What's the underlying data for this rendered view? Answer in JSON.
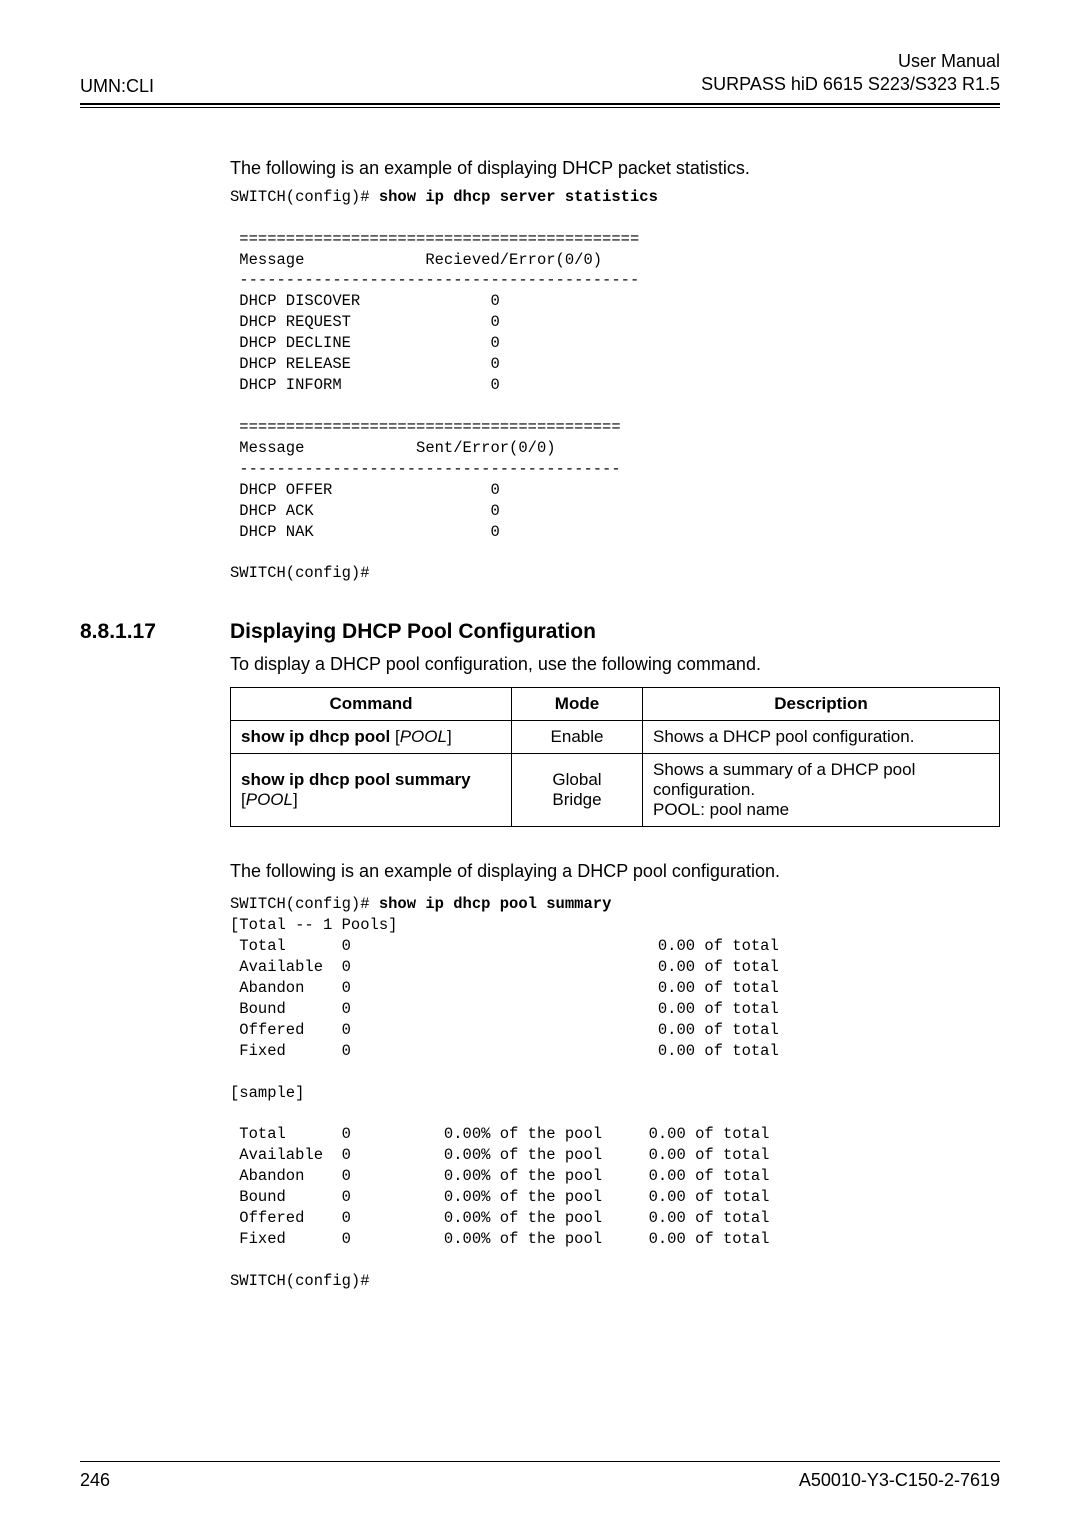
{
  "header": {
    "left": "UMN:CLI",
    "right_line1": "User Manual",
    "right_line2": "SURPASS hiD 6615 S223/S323 R1.5"
  },
  "intro_text": "The following is an example of displaying DHCP packet statistics.",
  "code1_prefix": "SWITCH(config)# ",
  "code1_cmd": "show ip dhcp server statistics",
  "code1_body": " ===========================================\n Message             Recieved/Error(0/0)\n -------------------------------------------\n DHCP DISCOVER              0\n DHCP REQUEST               0\n DHCP DECLINE               0\n DHCP RELEASE               0\n DHCP INFORM                0\n\n =========================================\n Message            Sent/Error(0/0)\n -----------------------------------------\n DHCP OFFER                 0\n DHCP ACK                   0\n DHCP NAK                   0\n\nSWITCH(config)#",
  "section": {
    "num": "8.8.1.17",
    "title": "Displaying DHCP Pool Configuration"
  },
  "para1": "To display a DHCP pool configuration, use the following command.",
  "table": {
    "head": {
      "c1": "Command",
      "c2": "Mode",
      "c3": "Description"
    },
    "row1": {
      "cmd_b": "show ip dhcp pool",
      "cmd_i": "POOL",
      "mode": "Enable",
      "desc": "Shows a DHCP pool configuration."
    },
    "row2": {
      "cmd_b": "show ip dhcp pool summary",
      "cmd_i": "POOL",
      "mode1": "Global",
      "mode2": "Bridge",
      "desc1": "Shows a summary of a DHCP pool configuration.",
      "desc2": "POOL: pool name"
    }
  },
  "para2": "The following is an example of displaying a DHCP pool configuration.",
  "code2_prefix": "SWITCH(config)# ",
  "code2_cmd": "show ip dhcp pool summary",
  "code2_body": "[Total -- 1 Pools]\n Total      0                                 0.00 of total\n Available  0                                 0.00 of total\n Abandon    0                                 0.00 of total\n Bound      0                                 0.00 of total\n Offered    0                                 0.00 of total\n Fixed      0                                 0.00 of total\n\n[sample]\n\n Total      0          0.00% of the pool     0.00 of total\n Available  0          0.00% of the pool     0.00 of total\n Abandon    0          0.00% of the pool     0.00 of total\n Bound      0          0.00% of the pool     0.00 of total\n Offered    0          0.00% of the pool     0.00 of total\n Fixed      0          0.00% of the pool     0.00 of total\n\nSWITCH(config)#",
  "footer": {
    "left": "246",
    "right": "A50010-Y3-C150-2-7619"
  }
}
